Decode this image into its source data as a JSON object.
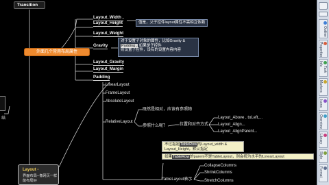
{
  "root": {
    "label": "Transition"
  },
  "orange_topic": {
    "label": "外面几个常用布局属性"
  },
  "branches": [
    {
      "label": "Layout_Width ,",
      "sub": "Layout_Height"
    },
    {
      "label": "Layout_Weight"
    },
    {
      "label": "Gravity"
    },
    {
      "label": "Layout_Gravity"
    },
    {
      "label": "Layout_Margin"
    },
    {
      "label": "Padding"
    }
  ],
  "notes": {
    "width_height": "值是，父子控件layout属性不需相互依赖",
    "gravity_line1": "对于设置子对象的属性，比如Gravity &",
    "gravity_line2": "Padding ,",
    "gravity_line3": "如果是子控件",
    "gravity_line4": "则设置子控件，设有的设置内容内容",
    "tablerow_line1_a": "不过指定",
    "tablerow_line1_b": "TableRow",
    "tablerow_line1_c": "的Layout_width &",
    "tablerow_line2": "Layout_Height，默认指定",
    "tablerow_line3_a": "如果",
    "tablerow_line3_b": "TableRow",
    "tablerow_line3_c": "的parent不是TableLayout，则会视为水平的LinearLayout"
  },
  "layouts": [
    {
      "label": "LinearLayout"
    },
    {
      "label": "FrameLayout"
    },
    {
      "label": "AbsoluteLayout"
    },
    {
      "label": "RelativeLayout"
    }
  ],
  "relative": {
    "branch_a": "既然是相对，应该有参照物",
    "branch_b": "参照什么呢？",
    "branch_c": "位置和对齐方式",
    "items": [
      "Layout_Above , toLeft,...",
      "Layout_Align...",
      "Layout_AlignParent..."
    ]
  },
  "table": {
    "label": "TableLayout表示",
    "items": [
      "CollapseColumns",
      "ShrinkColumns",
      "StretchColumns"
    ]
  },
  "layout_topic": {
    "title": "Layout -",
    "subtitle": "界面布局--像网页一样能布局好"
  },
  "left_fragment": "结",
  "toolbar": {
    "tabs": [
      "Outline",
      "Properties",
      "Task Info",
      "Markers",
      "Icons",
      "Overview",
      "Library",
      "Style",
      "Format"
    ],
    "colors": [
      "#3f7fd6",
      "#d65f3f",
      "#3fa04f",
      "#c8a630",
      "#8a52c8",
      "#3f9fc8",
      "#c83f7f",
      "#7fa03f",
      "#5f6f8f"
    ]
  }
}
